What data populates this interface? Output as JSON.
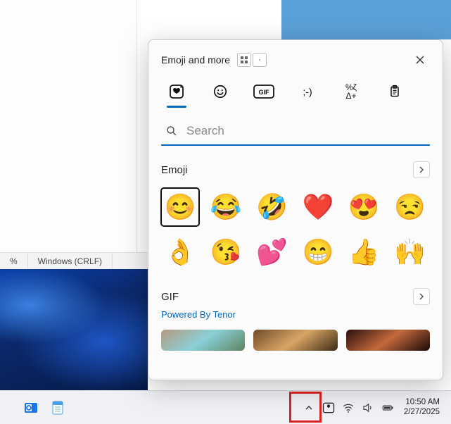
{
  "background": {
    "status_zoom": "%",
    "status_lineending": "Windows (CRLF)"
  },
  "picker": {
    "title": "Emoji and more",
    "search_placeholder": "Search",
    "sections": {
      "emoji": {
        "title": "Emoji"
      },
      "gif": {
        "title": "GIF",
        "powered_by": "Powered By Tenor"
      }
    },
    "tabs": [
      {
        "id": "recent",
        "icon": "heart-sticker-icon"
      },
      {
        "id": "emoji",
        "icon": "smiley-icon"
      },
      {
        "id": "gif",
        "icon": "gif-icon"
      },
      {
        "id": "kaomoji",
        "icon": "kaomoji-icon"
      },
      {
        "id": "symbols",
        "icon": "symbols-icon"
      },
      {
        "id": "clipboard",
        "icon": "clipboard-icon"
      }
    ],
    "emoji_grid": [
      "😊",
      "😂",
      "🤣",
      "❤️",
      "😍",
      "😒",
      "👌",
      "😘",
      "💕",
      "😁",
      "👍",
      "🙌"
    ]
  },
  "taskbar": {
    "time": "10:50 AM",
    "date": "2/27/2025"
  }
}
